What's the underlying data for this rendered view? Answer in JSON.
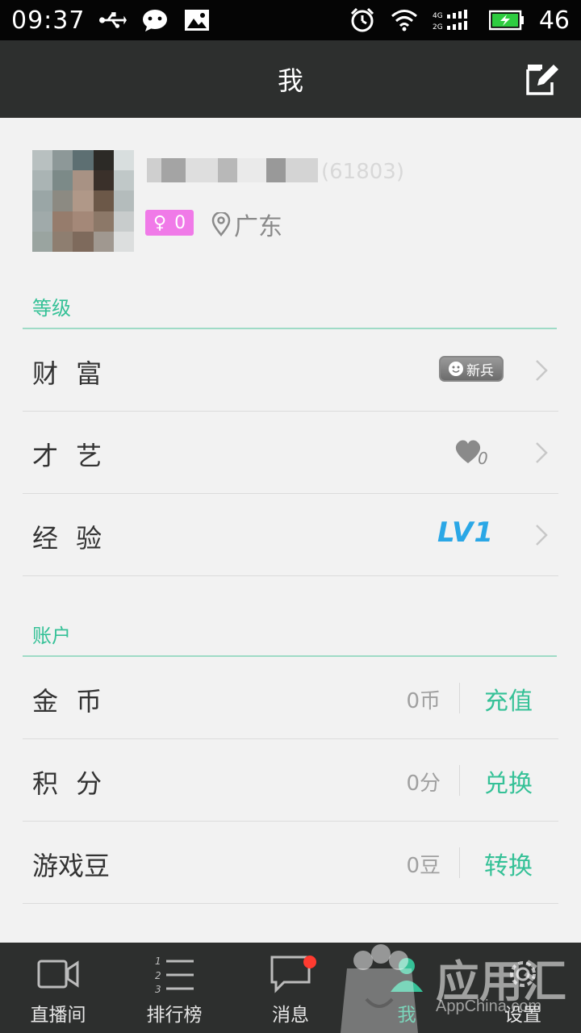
{
  "status_bar": {
    "time": "09:37",
    "battery_level": "46",
    "icons": [
      "usb-icon",
      "wechat-icon",
      "image-icon",
      "alarm-icon",
      "wifi-icon",
      "signal-4g-2g-icon",
      "battery-charging-icon"
    ]
  },
  "header": {
    "title": "我",
    "edit_icon": "edit-icon"
  },
  "profile": {
    "name": "",
    "id_text": "(61803)",
    "gender_symbol": "♀",
    "gender_count": "0",
    "location": "广东",
    "gender_badge_color": "#f07ae8"
  },
  "sections": {
    "level": {
      "title": "等级",
      "rows": [
        {
          "label": "财 富",
          "badge": "新兵"
        },
        {
          "label": "才 艺",
          "heart_count": "0"
        },
        {
          "label": "经 验",
          "lv_text": "LV1"
        }
      ]
    },
    "account": {
      "title": "账户",
      "rows": [
        {
          "label": "金 币",
          "value": "0币",
          "action": "充值"
        },
        {
          "label": "积 分",
          "value": "0分",
          "action": "兑换"
        },
        {
          "label": "游戏豆",
          "value": "0豆",
          "action": "转换"
        }
      ]
    }
  },
  "bottom_nav": {
    "items": [
      {
        "label": "直播间",
        "icon": "video-camera-icon"
      },
      {
        "label": "排行榜",
        "icon": "ranking-list-icon"
      },
      {
        "label": "消息",
        "icon": "message-bubble-icon"
      },
      {
        "label": "我",
        "icon": "person-icon"
      },
      {
        "label": "设置",
        "icon": "gear-icon"
      }
    ]
  },
  "watermark": {
    "text": "应用汇",
    "sub": "AppChina.com"
  },
  "colors": {
    "accent": "#35c197",
    "app_bar": "#2d2f2e",
    "status_bar": "#050505",
    "background": "#f2f2f2",
    "lv_blue": "#2aa7e6",
    "notification_dot": "#ff3b30"
  }
}
